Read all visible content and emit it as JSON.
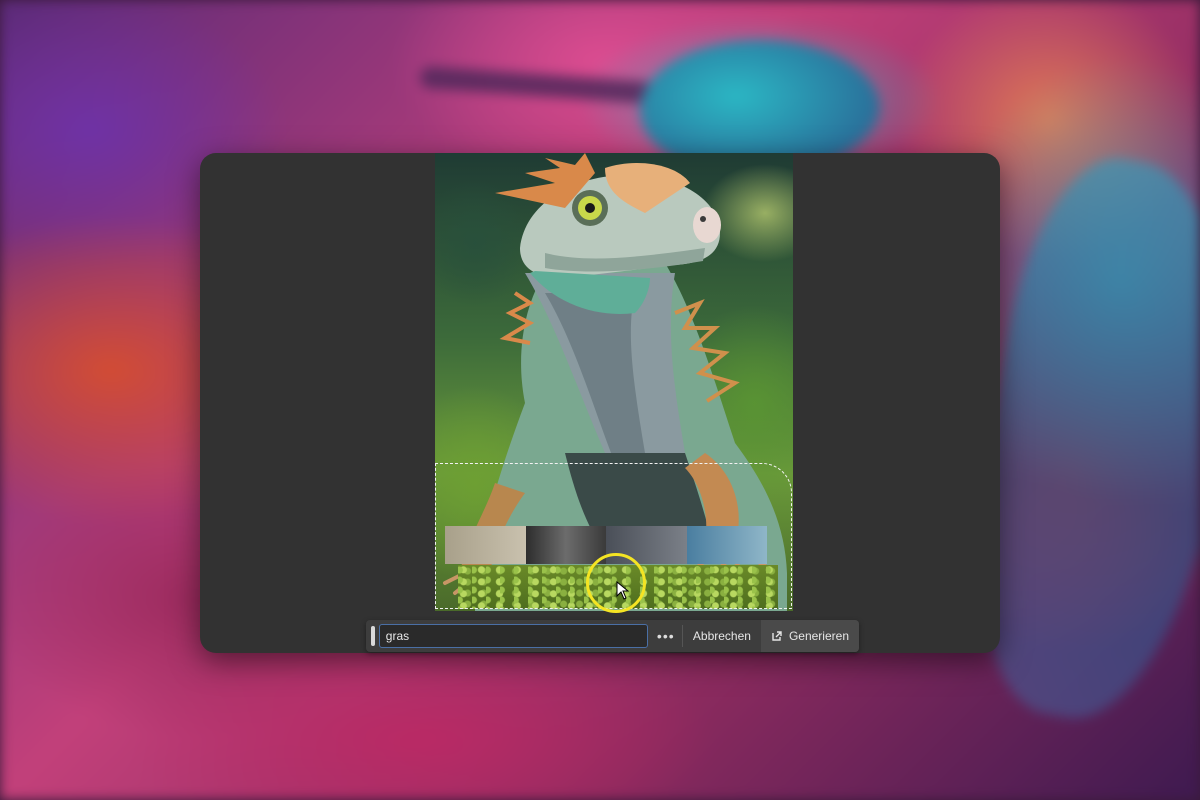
{
  "prompt_bar": {
    "input_value": "gras",
    "more_label": "•••",
    "cancel_label": "Abbrechen",
    "generate_label": "Generieren",
    "generate_icon": "open-external-icon"
  },
  "canvas": {
    "selection_style": "marching-ants",
    "cursor_highlight_color": "#f4e423"
  },
  "colors": {
    "panel_bg": "#323232",
    "input_border": "#4a6fa5",
    "button_bg": "#4a4a4a"
  }
}
